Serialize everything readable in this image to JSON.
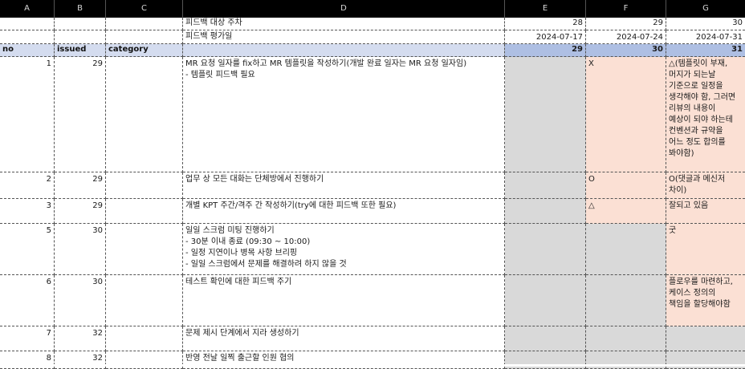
{
  "columns": [
    "A",
    "B",
    "C",
    "D",
    "E",
    "F",
    "G"
  ],
  "meta_rows": [
    {
      "label": "피드백 대상 주차",
      "e": "28",
      "f": "29",
      "g": "30"
    },
    {
      "label": "피드백 평가일",
      "e": "2024-07-17",
      "f": "2024-07-24",
      "g": "2024-07-31"
    }
  ],
  "header": {
    "no": "no",
    "issued": "issued",
    "category": "category",
    "e": "29",
    "f": "30",
    "g": "31"
  },
  "rows": [
    {
      "no": "1",
      "issued": "29",
      "category": "",
      "text": "MR 요청 일자를 fix하고 MR 템플릿을 작성하기(개발 완료 일자는 MR 요청 일자임)\n- 템플릿 피드백 필요",
      "e": "",
      "f": "X",
      "g": "△(템플릿이 부재,\n머지가 되는날\n기준으로 일정을\n생각해야 함, 그러면\n리뷰의 내용이\n예상이 되야 하는테\n컨벤션과 규약을\n어느 정도 합의를\n봐야함)"
    },
    {
      "no": "2",
      "issued": "29",
      "category": "",
      "text": "업무 상 모든 대화는 단체방에서 진행하기",
      "e": "",
      "f": "O",
      "g": "O(댓글과 메신저\n차이)"
    },
    {
      "no": "3",
      "issued": "29",
      "category": "",
      "text": "개별 KPT 주간/격주 간 작성하기(try에 대한 피드백 또한 필요)",
      "e": "",
      "f": "△",
      "g": "잘되고 있음"
    },
    {
      "no": "5",
      "issued": "30",
      "category": "",
      "text": "일일 스크럼 미팅 진행하기\n- 30분 이내 종료 (09:30 ~ 10:00)\n- 일정 지연이나 병목 사항 브리핑\n- 일일 스크럼에서 문제를 해결하려 하지 않을 것",
      "e": "",
      "f": "",
      "g": "굿"
    },
    {
      "no": "6",
      "issued": "30",
      "category": "",
      "text": "테스트 확인에 대한 피드백 주기",
      "e": "",
      "f": "",
      "g": "플로우를 마련하고,\n케이스 정의의\n책임을 할당해야함"
    },
    {
      "no": "7",
      "issued": "32",
      "category": "",
      "text": "문제 제시 단계에서 지라 생성하기",
      "e": "",
      "f": "",
      "g": ""
    },
    {
      "no": "8",
      "issued": "32",
      "category": "",
      "text": "반영 전날 일찍 출근할 인원 협의",
      "e": "",
      "f": "",
      "g": ""
    }
  ],
  "colors": {
    "header_bg": "#d4dcef",
    "header_num_bg": "#aebfe3",
    "grey": "#d9d9d9",
    "peach": "#fbe0d4"
  }
}
